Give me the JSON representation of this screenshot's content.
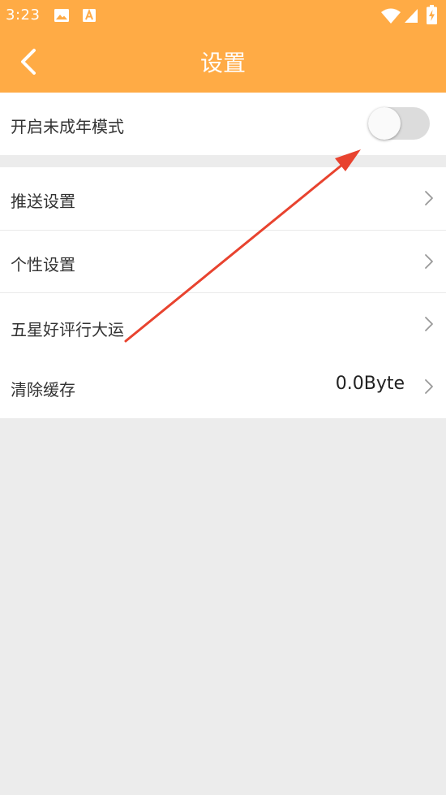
{
  "status_bar": {
    "time": "3:23",
    "icons": [
      "image-icon",
      "text-notification-icon",
      "wifi-icon",
      "signal-icon",
      "battery-charging-icon"
    ]
  },
  "header": {
    "title": "设置",
    "back_icon": "chevron-left-icon"
  },
  "settings": {
    "minor_mode": {
      "label": "开启未成年模式",
      "enabled": false
    },
    "push": {
      "label": "推送设置"
    },
    "personal": {
      "label": "个性设置"
    },
    "rating": {
      "label": "五星好评行大运"
    },
    "cache": {
      "label": "清除缓存",
      "value": "0.0Byte"
    }
  },
  "colors": {
    "header_bg": "#ffab45",
    "page_bg": "#ececec",
    "annotation_arrow": "#e8432f"
  }
}
